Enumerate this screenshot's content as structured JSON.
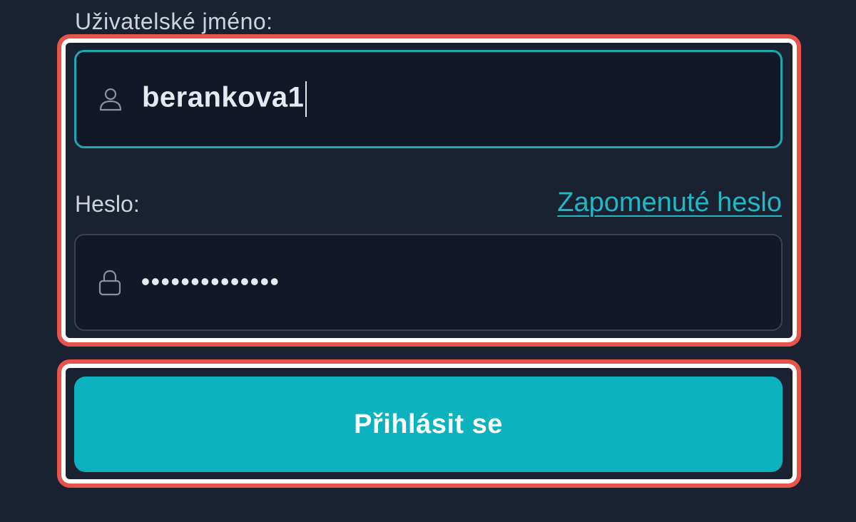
{
  "form": {
    "username_label": "Uživatelské jméno:",
    "username_value": "berankova1",
    "username_icon": "user-icon",
    "password_label": "Heslo:",
    "password_masked": "••••••••••••••",
    "password_icon": "lock-icon",
    "forgot_password_link": "Zapomenuté heslo",
    "login_button": "Přihlásit se"
  },
  "colors": {
    "background": "#1a2231",
    "field_background": "#121827",
    "accent": "#0cb3bf",
    "link": "#1fb8c4",
    "highlight_outer": "#e8534c",
    "highlight_inner": "#ffffff"
  }
}
